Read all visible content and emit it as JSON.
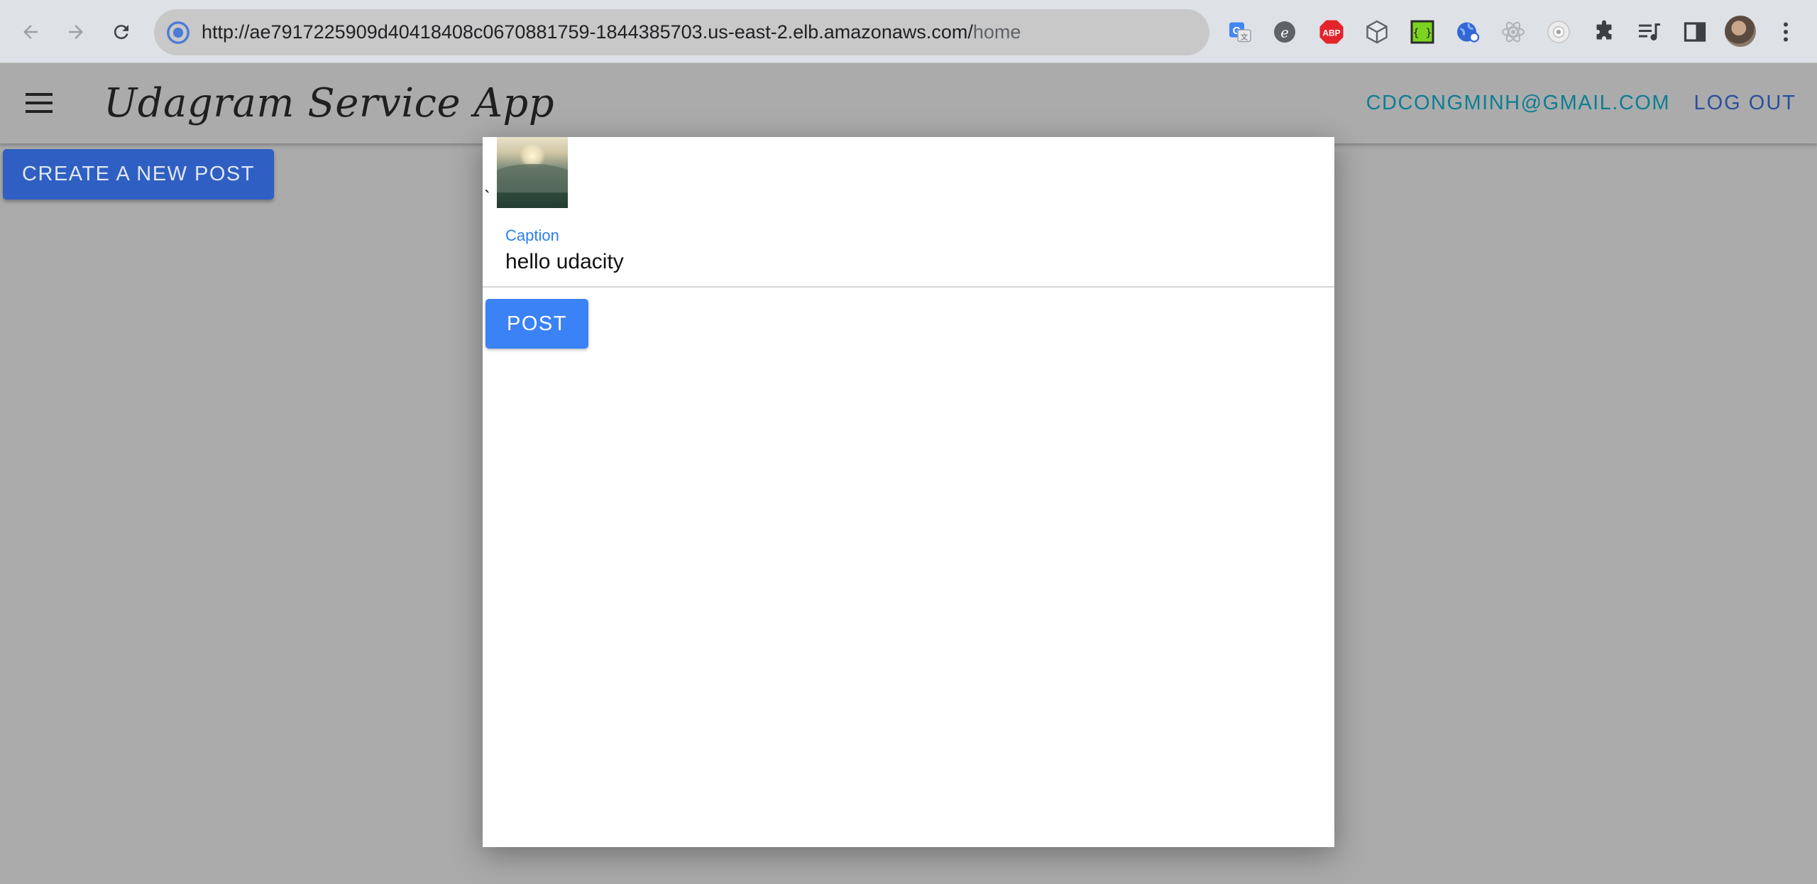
{
  "browser": {
    "url_main": "http://ae7917225909d40418408c0670881759-1844385703.us-east-2.elb.amazonaws.com/",
    "url_path": "home",
    "nav_icons": [
      "back-icon",
      "forward-icon",
      "reload-icon"
    ],
    "extension_icons": [
      "google-translate-icon",
      "extension-e-icon",
      "adblock-plus-icon",
      "cube-icon",
      "json-formatter-icon",
      "globe-icon",
      "react-devtools-icon",
      "camera-icon",
      "extensions-puzzle-icon",
      "reading-list-icon",
      "side-panel-icon"
    ],
    "adblock_label": "ABP",
    "json_label": "{ }"
  },
  "header": {
    "title": "Udagram Service App",
    "user_email": "CDCONGMINH@GMAIL.COM",
    "logout_label": "LOG OUT"
  },
  "main": {
    "create_post_label": "CREATE A NEW POST"
  },
  "modal": {
    "stray_text": "`",
    "caption_label": "Caption",
    "caption_value": "hello udacity",
    "post_label": "POST"
  },
  "colors": {
    "accent_blue": "#3b82f6",
    "create_button": "#2f5fc2",
    "email_teal": "#0d7e93",
    "logout_blue": "#2a4f9c",
    "overlay_gray": "#aaaaaa"
  }
}
